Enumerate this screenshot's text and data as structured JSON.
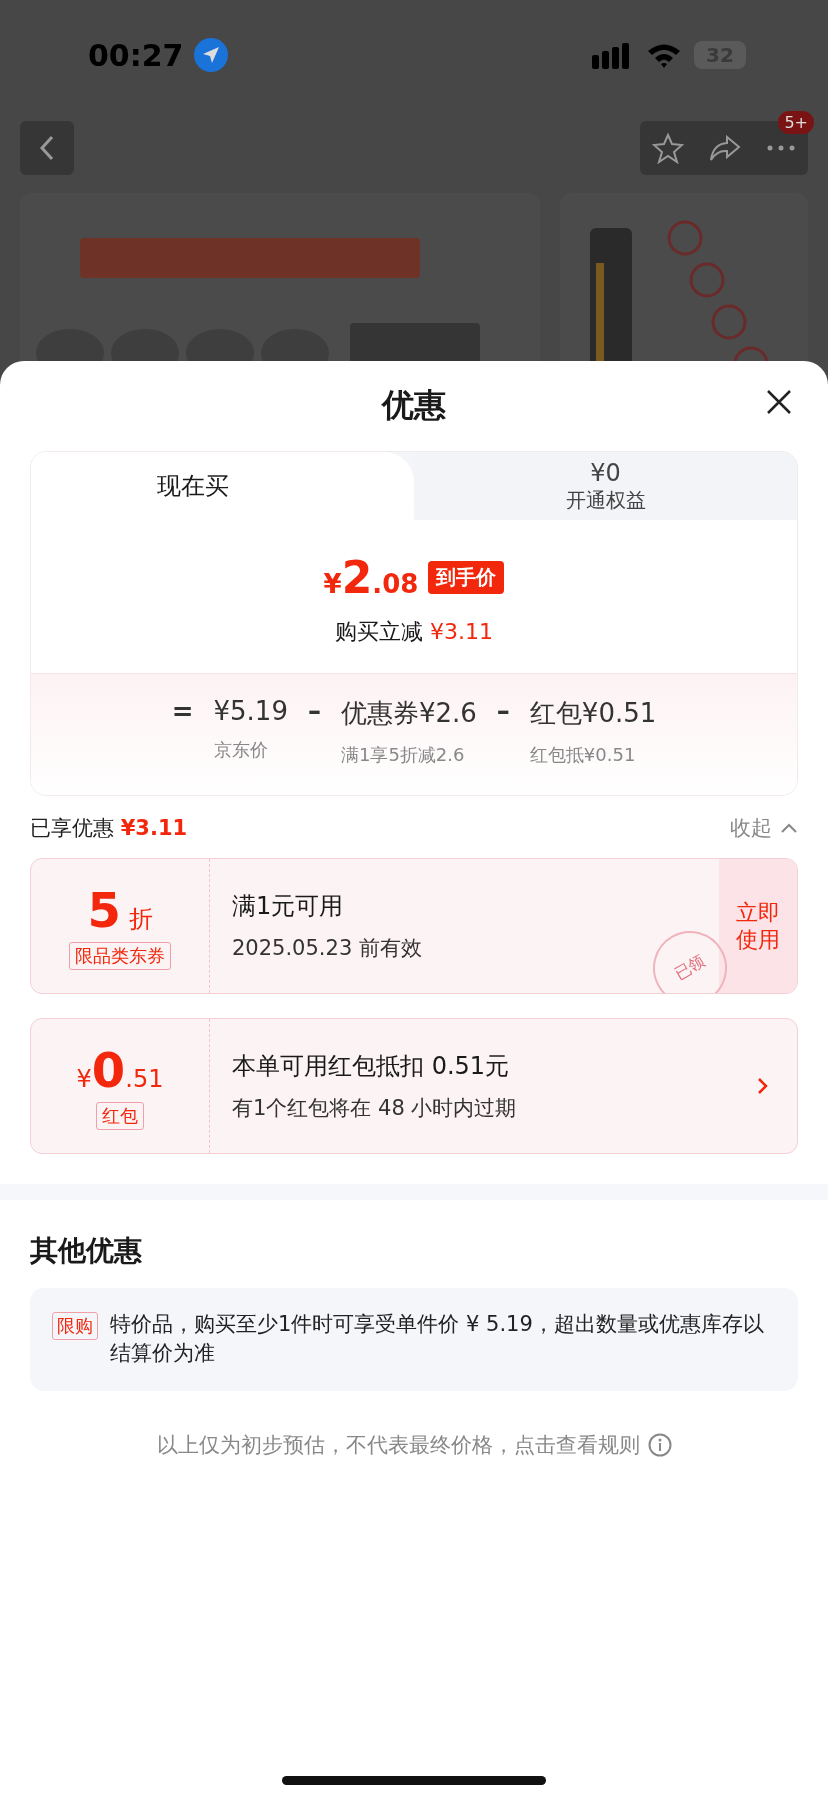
{
  "status_bar": {
    "time": "00:27",
    "battery": "32"
  },
  "nav": {
    "badge": "5+"
  },
  "sheet": {
    "title": "优惠",
    "tabs": [
      {
        "label": "现在买",
        "selected": true
      },
      {
        "price": "¥0",
        "label": "开通权益",
        "selected": false
      }
    ],
    "price": {
      "currency": "¥",
      "integer": "2",
      "decimal": ".08",
      "tag": "到手价"
    },
    "saving": {
      "label": "购买立减",
      "amount": "¥3.11"
    },
    "breakdown": [
      {
        "kind": "operator",
        "text": "="
      },
      {
        "kind": "term",
        "value": "¥5.19",
        "note": "京东价"
      },
      {
        "kind": "operator",
        "text": "–"
      },
      {
        "kind": "term",
        "label": "优惠券",
        "value": "¥2.6",
        "note": "满1享5折减2.6"
      },
      {
        "kind": "operator",
        "text": "–"
      },
      {
        "kind": "term",
        "label": "红包",
        "value": "¥0.51",
        "note": "红包抵¥0.51"
      }
    ],
    "applied": {
      "label": "已享优惠",
      "amount": "¥3.11",
      "toggle": "收起",
      "expanded": true
    },
    "coupons": [
      {
        "kind": "discount",
        "value": "5",
        "unit": "折",
        "tag": "限品类东券",
        "title": "满1元可用",
        "subtitle": "2025.05.23 前有效",
        "action": "立即使用",
        "stamp": "已领"
      },
      {
        "kind": "redpacket",
        "currency": "¥",
        "integer": "0",
        "decimal": ".51",
        "tag": "红包",
        "title": "本单可用红包抵扣 0.51元",
        "subtitle": "有1个红包将在 48 小时内过期"
      }
    ],
    "other": {
      "title": "其他优惠",
      "items": [
        {
          "tag": "限购",
          "text": "特价品，购买至少1件时可享受单件价 ¥ 5.19，超出数量或优惠库存以结算价为准"
        }
      ]
    },
    "footer": "以上仅为初步预估，不代表最终价格，点击查看规则"
  }
}
